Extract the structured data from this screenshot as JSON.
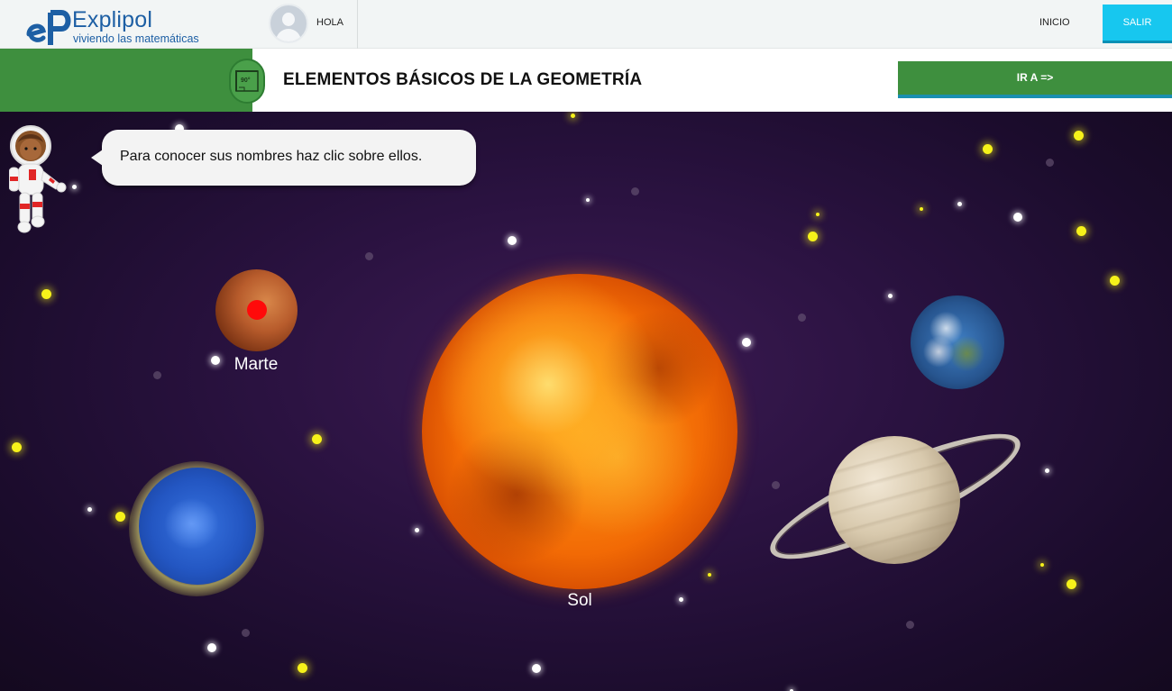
{
  "header": {
    "brand": "Explipol",
    "tagline": "viviendo las matemáticas",
    "greeting": "HOLA",
    "nav_home": "INICIO",
    "exit_label": "SALIR"
  },
  "lesson": {
    "title": "ELEMENTOS BÁSICOS DE LA GEOMETRÍA",
    "goto_label": "IR A =>",
    "badge_icon": "protractor-90-icon"
  },
  "scene": {
    "instruction": "Para conocer sus nombres haz clic sobre ellos.",
    "planets": {
      "sun": "Sol",
      "mars": "Marte"
    }
  },
  "colors": {
    "header_bg": "#f2f5f5",
    "brand_blue": "#1d5fa4",
    "green": "#3e8f3e",
    "exit_cyan": "#17c7ef",
    "space_purple": "#2a1240",
    "mars_marker": "#ff0a0a"
  }
}
